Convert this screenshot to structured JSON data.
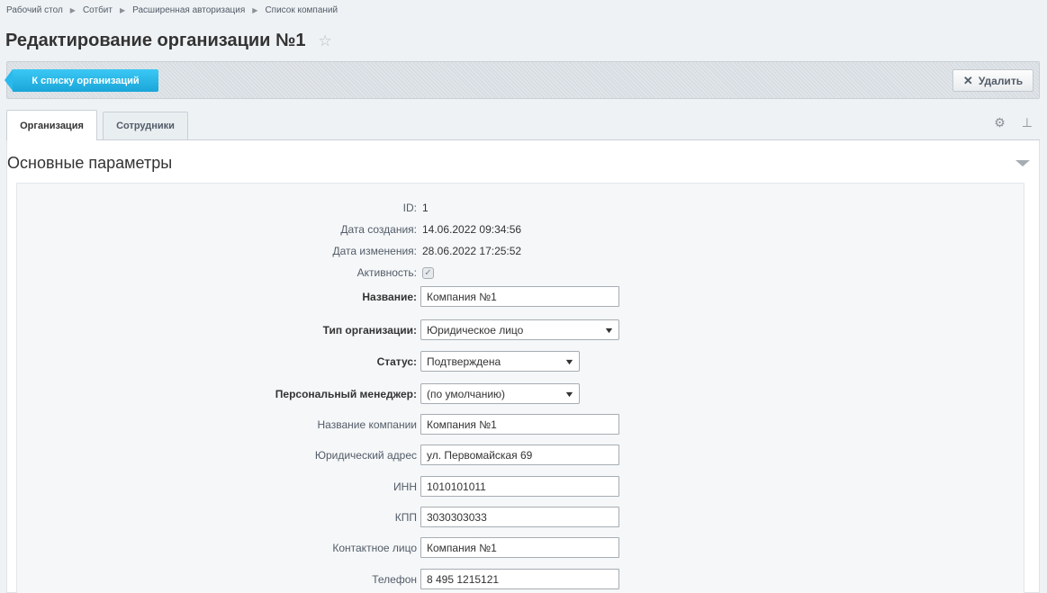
{
  "breadcrumb": [
    "Рабочий стол",
    "Сотбит",
    "Расширенная авторизация",
    "Список компаний"
  ],
  "title": "Редактирование организации №1",
  "toolbar": {
    "back_label": "К списку организаций",
    "delete_label": "Удалить"
  },
  "tabs": [
    "Организация",
    "Сотрудники"
  ],
  "section": {
    "title": "Основные параметры"
  },
  "info": {
    "id_label": "ID:",
    "id_value": "1",
    "created_label": "Дата создания:",
    "created_value": "14.06.2022 09:34:56",
    "modified_label": "Дата изменения:",
    "modified_value": "28.06.2022 17:25:52",
    "active_label": "Активность:",
    "active_checked": true
  },
  "fields": {
    "name_label": "Название:",
    "name_value": "Компания №1",
    "type_label": "Тип организации:",
    "type_value": "Юридическое лицо",
    "status_label": "Статус:",
    "status_value": "Подтверждена",
    "manager_label": "Персональный менеджер:",
    "manager_value": "(по умолчанию)",
    "company_label": "Название компании",
    "company_value": "Компания №1",
    "address_label": "Юридический адрес",
    "address_value": "ул. Первомайская 69",
    "inn_label": "ИНН",
    "inn_value": "1010101011",
    "kpp_label": "КПП",
    "kpp_value": "3030303033",
    "contact_label": "Контактное лицо",
    "contact_value": "Компания №1",
    "phone_label": "Телефон",
    "phone_value": "8 495 1215121"
  },
  "colors": {
    "accent": "#1aa6d9",
    "background": "#eef2f4"
  }
}
